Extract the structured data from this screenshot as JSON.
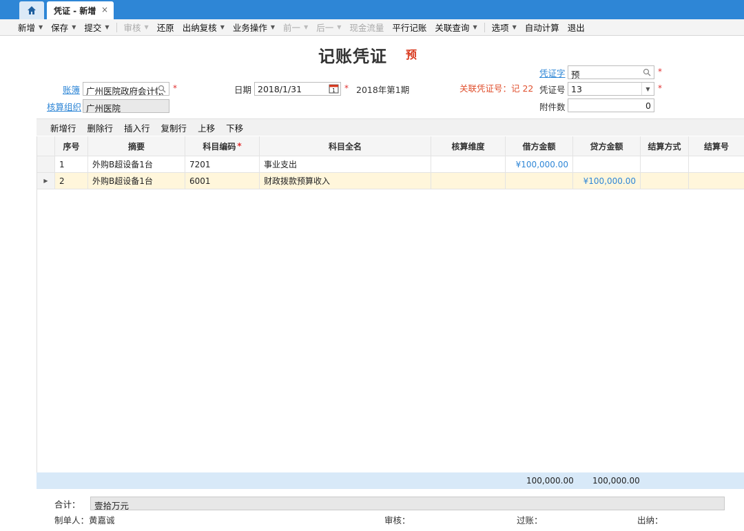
{
  "tabs": {
    "home_icon": "home-icon",
    "active_tab": "凭证 - 新增",
    "close": "×"
  },
  "toolbar": [
    {
      "label": "新增",
      "caret": true,
      "disabled": false
    },
    {
      "label": "保存",
      "caret": true,
      "disabled": false
    },
    {
      "label": "提交",
      "caret": true,
      "disabled": false
    },
    {
      "label": "审核",
      "caret": true,
      "disabled": true
    },
    {
      "label": "还原",
      "caret": false,
      "disabled": false
    },
    {
      "label": "出纳复核",
      "caret": true,
      "disabled": false
    },
    {
      "label": "业务操作",
      "caret": true,
      "disabled": false
    },
    {
      "label": "前一",
      "caret": true,
      "disabled": true
    },
    {
      "label": "后一",
      "caret": true,
      "disabled": true
    },
    {
      "label": "现金流量",
      "caret": false,
      "disabled": true
    },
    {
      "label": "平行记账",
      "caret": false,
      "disabled": false
    },
    {
      "label": "关联查询",
      "caret": true,
      "disabled": false
    },
    {
      "label": "选项",
      "caret": true,
      "disabled": false
    },
    {
      "label": "自动计算",
      "caret": false,
      "disabled": false
    },
    {
      "label": "退出",
      "caret": false,
      "disabled": false
    }
  ],
  "header": {
    "title": "记账凭证",
    "tag": "预"
  },
  "form": {
    "book_label": "账簿",
    "book_value": "广州医院政府会计帐",
    "org_label": "核算组织",
    "org_value": "广州医院",
    "date_label": "日期",
    "date_value": "2018/1/31",
    "date_cal_day": "1",
    "period": "2018年第1期",
    "related_voucher": "关联凭证号：记 22",
    "voucher_word_label": "凭证字",
    "voucher_word_value": "预",
    "voucher_no_label": "凭证号",
    "voucher_no_value": "13",
    "attachments_label": "附件数",
    "attachments_value": "0",
    "required_mark": "*"
  },
  "grid_tools": [
    "新增行",
    "删除行",
    "插入行",
    "复制行",
    "上移",
    "下移"
  ],
  "columns": {
    "seq": "序号",
    "summary": "摘要",
    "code": "科目编码",
    "name": "科目全名",
    "dimension": "核算维度",
    "debit": "借方金额",
    "credit": "贷方金额",
    "settle": "结算方式",
    "settle_no": "结算号"
  },
  "rows": [
    {
      "seq": "1",
      "summary": "外购B超设备1台",
      "code": "7201",
      "name": "事业支出",
      "dimension": "",
      "debit": "¥100,000.00",
      "credit": "",
      "settle": "",
      "settle_no": ""
    },
    {
      "seq": "2",
      "summary": "外购B超设备1台",
      "code": "6001",
      "name": "财政拨款预算收入",
      "dimension": "",
      "debit": "",
      "credit": "¥100,000.00",
      "settle": "",
      "settle_no": ""
    }
  ],
  "totals": {
    "debit": "100,000.00",
    "credit": "100,000.00"
  },
  "footer": {
    "sum_label": "合计：",
    "sum_text": "壹拾万元",
    "preparer_label": "制单人：",
    "preparer": "黄嘉诚",
    "auditor_label": "审核：",
    "poster_label": "过账：",
    "cashier_label": "出纳："
  },
  "colors": {
    "accent": "#2e86d6",
    "tag_red": "#d9391e",
    "selected_row": "#fff6db",
    "totals_bar": "#d8e9f8"
  }
}
